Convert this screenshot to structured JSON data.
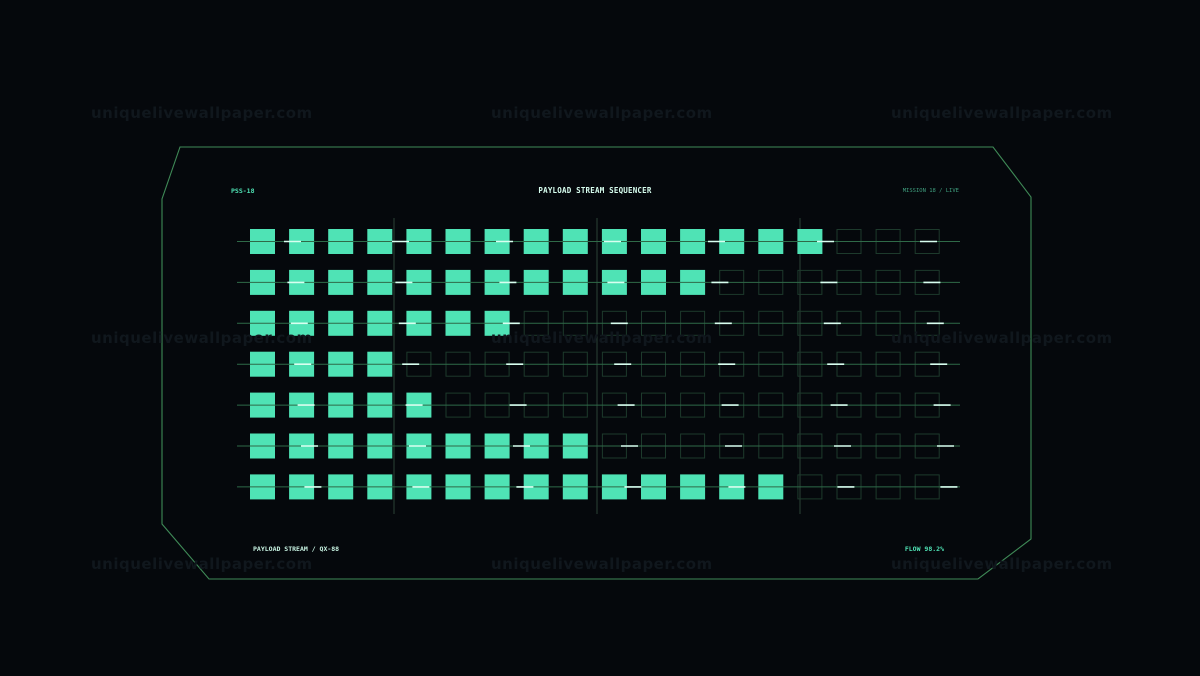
{
  "watermark": "uniquelivewallpaper.com",
  "header": {
    "left_label": "PSS-18",
    "title": "PAYLOAD STREAM SEQUENCER",
    "right_label": "MISSION 18 / LIVE"
  },
  "footer": {
    "left_label": "PAYLOAD STREAM / QX-88",
    "right_label": "FLOW 98.2%"
  },
  "colors": {
    "background": "#05080c",
    "accent": "#4fe3b5",
    "frame": "#3f8a57",
    "empty_cell": "#1d3a2c",
    "row_line": "#2f6a48",
    "divider": "#2a4236",
    "marker": "#d8fff0"
  },
  "sequencer": {
    "columns": 18,
    "rows": 7,
    "filled_per_row": [
      15,
      12,
      7,
      4,
      5,
      9,
      14
    ]
  }
}
